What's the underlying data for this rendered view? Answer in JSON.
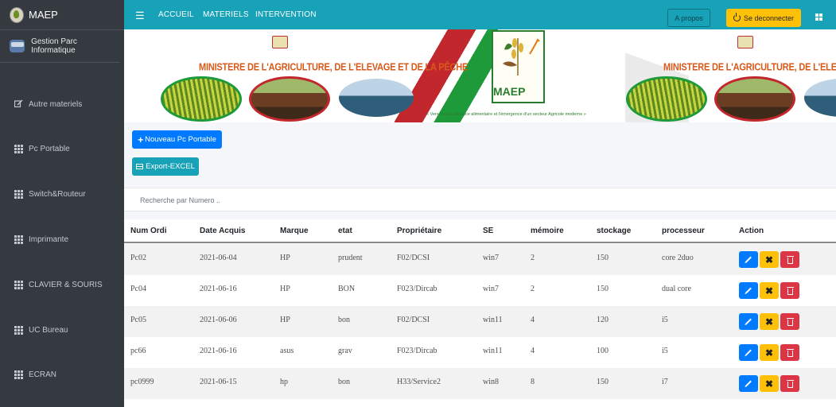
{
  "app": {
    "brand": "MAEP",
    "user_title": "Gestion Parc Informatique"
  },
  "sidebar": {
    "items": [
      {
        "label": "Autre materiels",
        "icon": "edit-icon"
      },
      {
        "label": "Pc Portable",
        "icon": "grid-icon"
      },
      {
        "label": "Switch&Routeur",
        "icon": "grid-icon"
      },
      {
        "label": "Imprimante",
        "icon": "grid-icon"
      },
      {
        "label": "CLAVIER & SOURIS",
        "icon": "grid-icon"
      },
      {
        "label": "UC Bureau",
        "icon": "grid-icon"
      },
      {
        "label": "ECRAN",
        "icon": "grid-icon"
      }
    ]
  },
  "topbar": {
    "links": [
      "ACCUEIL",
      "MATERIELS",
      "INTERVENTION"
    ],
    "apropos": "A propos",
    "logout": "Se deconnecter"
  },
  "banner": {
    "title_left": "MINISTERE DE L'AGRICULTURE, DE L'ELEVAGE ET DE LA PÊCHE",
    "title_right": "MINISTERE DE L'AGRICULTURE, DE L'ELEVAGE ET DE LA PÊCHE",
    "logo_text": "MAEP",
    "slogan": "« Vers l'autosuffisance alimentaire et l'émergence d'un secteur Agricole moderne »"
  },
  "actions": {
    "new_button": "Nouveau Pc Portable",
    "export_button": "Export-EXCEL"
  },
  "search": {
    "placeholder": "Recherche par Numero .."
  },
  "table": {
    "headers": [
      "Num Ordi",
      "Date Acquis",
      "Marque",
      "etat",
      "Propriétaire",
      "SE",
      "mémoire",
      "stockage",
      "processeur",
      "Action"
    ],
    "rows": [
      [
        "Pc02",
        "2021-06-04",
        "HP",
        "prudent",
        "F02/DCSI",
        "win7",
        "2",
        "150",
        "core 2duo"
      ],
      [
        "Pc04",
        "2021-06-16",
        "HP",
        "BON",
        "F023/Dircab",
        "win7",
        "2",
        "150",
        "dual core"
      ],
      [
        "Pc05",
        "2021-06-06",
        "HP",
        "bon",
        "F02/DCSI",
        "win11",
        "4",
        "120",
        "i5"
      ],
      [
        "pc66",
        "2021-06-16",
        "asus",
        "grav",
        "F023/Dircab",
        "win11",
        "4",
        "100",
        "i5"
      ],
      [
        "pc0999",
        "2021-06-15",
        "hp",
        "bon",
        "H33/Service2",
        "win8",
        "8",
        "150",
        "i7"
      ]
    ]
  },
  "colors": {
    "sidebar": "#343a40",
    "topbar": "#17a2b8",
    "primary": "#007bff",
    "warning": "#ffc107",
    "danger": "#dc3545"
  }
}
